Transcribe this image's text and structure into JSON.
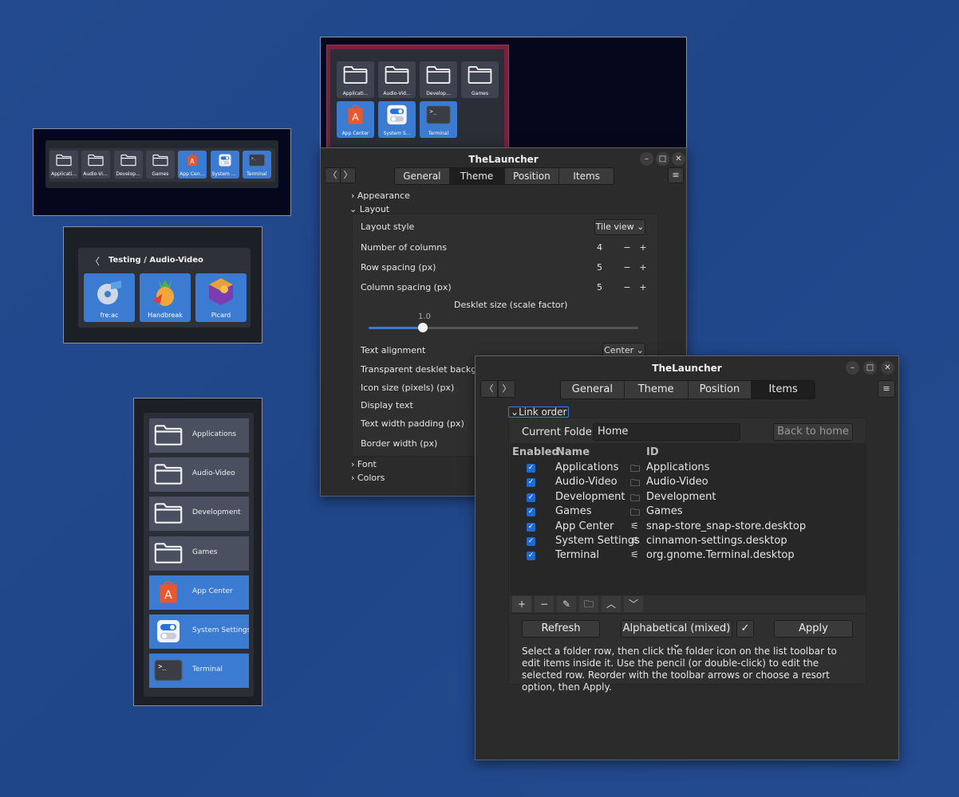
{
  "row_desklet": {
    "tiles": [
      "Applicati...",
      "Audio-Vid...",
      "Develop...",
      "Games",
      "App Center",
      "System S...",
      "Terminal"
    ]
  },
  "audio_desklet": {
    "back_glyph": "〈",
    "title": "Testing / Audio-Video",
    "apps": [
      "fre:ac",
      "Handbreak",
      "Picard"
    ]
  },
  "column_desklet": {
    "items": [
      "Applications",
      "Audio-Video",
      "Development",
      "Games",
      "App Center",
      "System Settings",
      "Terminal"
    ]
  },
  "grid_desklet": {
    "tiles": [
      "Applicati...",
      "Audio-Vid...",
      "Develop...",
      "Games",
      "App Center",
      "System S...",
      "Terminal"
    ]
  },
  "theme_window": {
    "title": "TheLauncher",
    "tabs": [
      "General",
      "Theme",
      "Position",
      "Items"
    ],
    "active_tab": "Theme",
    "sections": {
      "appearance": "Appearance",
      "layout": "Layout",
      "font": "Font",
      "colors": "Colors"
    },
    "layout_style_label": "Layout style",
    "layout_style_value": "Tile view",
    "columns_label": "Number of columns",
    "columns_value": "4",
    "row_spacing_label": "Row spacing (px)",
    "row_spacing_value": "5",
    "col_spacing_label": "Column spacing (px)",
    "col_spacing_value": "5",
    "desklet_size_label": "Desklet size (scale factor)",
    "desklet_size_value": "1.0",
    "text_alignment_label": "Text alignment",
    "text_alignment_value": "Center",
    "transparent_bg_label": "Transparent desklet backgrou",
    "icon_size_label": "Icon size (pixels) (px)",
    "display_text_label": "Display text",
    "text_width_label": "Text width padding (px)",
    "border_width_label": "Border width (px)",
    "minus": "−",
    "plus": "+"
  },
  "items_window": {
    "title": "TheLauncher",
    "tabs": [
      "General",
      "Theme",
      "Position",
      "Items"
    ],
    "active_tab": "Items",
    "section": "Link order",
    "current_folder_label": "Current Folder",
    "current_folder_value": "Home",
    "back_home": "Back to home",
    "columns": {
      "enabled": "Enabled",
      "name": "Name",
      "id": "ID"
    },
    "rows": [
      {
        "name": "Applications",
        "id": "Applications",
        "icon": "folder-icon"
      },
      {
        "name": "Audio-Video",
        "id": "Audio-Video",
        "icon": "folder-icon"
      },
      {
        "name": "Development",
        "id": "Development",
        "icon": "folder-icon"
      },
      {
        "name": "Games",
        "id": "Games",
        "icon": "folder-icon"
      },
      {
        "name": "App Center",
        "id": "snap-store_snap-store.desktop",
        "icon": "launcher-icon"
      },
      {
        "name": "System Settings",
        "id": "cinnamon-settings.desktop",
        "icon": "launcher-icon"
      },
      {
        "name": "Terminal",
        "id": "org.gnome.Terminal.desktop",
        "icon": "launcher-icon"
      }
    ],
    "toolbar": [
      "+",
      "−",
      "✎",
      "🗀",
      "︿",
      "﹀"
    ],
    "refresh": "Refresh",
    "sort_value": "Alphabetical (mixed)",
    "apply": "Apply",
    "help_text": "Select a folder row, then click the folder icon on the list toolbar to edit items inside it. Use the pencil (or double-click) to edit the selected row. Reorder with the toolbar arrows or choose a resort option, then Apply."
  },
  "colors": {
    "accent": "#3b7bd1",
    "desktop": "#234a8e",
    "checkbox": "#1e6ad0"
  }
}
